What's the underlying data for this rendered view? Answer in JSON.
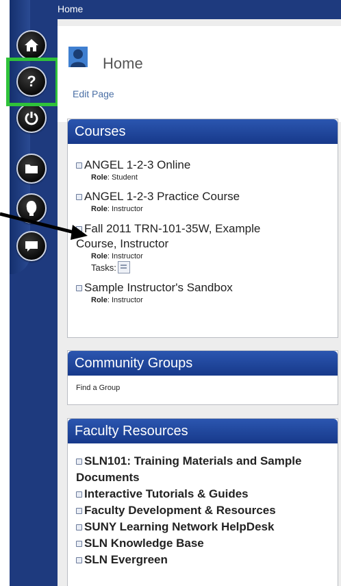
{
  "topbar": {
    "breadcrumb": "Home"
  },
  "rail": {
    "buttons": [
      {
        "name": "home-icon",
        "glyph": "⌂"
      },
      {
        "name": "help-icon",
        "glyph": "?"
      },
      {
        "name": "power-icon",
        "glyph": "⏻"
      },
      {
        "name": "folder-icon",
        "glyph": "▬"
      },
      {
        "name": "profile-icon",
        "glyph": "●"
      },
      {
        "name": "chat-icon",
        "glyph": "▰"
      }
    ]
  },
  "page": {
    "title": "Home",
    "edit_link": "Edit Page"
  },
  "courses": {
    "header": "Courses",
    "items": [
      {
        "title": "ANGEL 1-2-3 Online",
        "role_label": "Role",
        "role": ": Student"
      },
      {
        "title": "ANGEL 1-2-3 Practice Course",
        "role_label": "Role",
        "role": ": Instructor"
      },
      {
        "title": "Fall 2011 TRN-101-35W, Example Course, Instructor",
        "role_label": "Role",
        "role": ": Instructor",
        "tasks": "Tasks:"
      },
      {
        "title": "Sample Instructor's Sandbox",
        "role_label": "Role",
        "role": ": Instructor"
      }
    ]
  },
  "community": {
    "header": "Community Groups",
    "link": "Find a Group"
  },
  "faculty": {
    "header": "Faculty Resources",
    "items": [
      "SLN101: Training Materials and Sample Documents",
      "Interactive Tutorials & Guides",
      "Faculty Development & Resources",
      "SUNY Learning Network HelpDesk",
      "SLN Knowledge Base",
      "SLN Evergreen"
    ]
  },
  "colors": {
    "rail": "#1e3a7e",
    "panel_head": "#1f47a0",
    "highlight": "#2fc23a"
  }
}
